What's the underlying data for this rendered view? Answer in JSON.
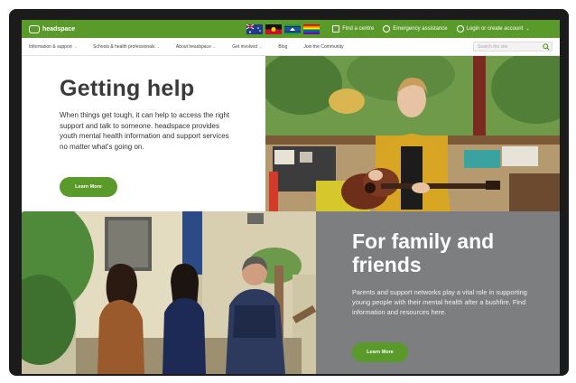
{
  "brand": {
    "name": "headspace",
    "color": "#5a9a2a"
  },
  "topbar": {
    "flags": [
      "australian-flag",
      "aboriginal-flag",
      "torres-strait-islander-flag",
      "rainbow-pride-flag"
    ],
    "find_centre": "Find a centre",
    "emergency": "Emergency assistance",
    "login": "Login or create account"
  },
  "nav": {
    "items": [
      {
        "label": "Information & support",
        "caret": "⌄"
      },
      {
        "label": "Schools & health professionals",
        "caret": "⌄"
      },
      {
        "label": "About headspace",
        "caret": "⌄"
      },
      {
        "label": "Get involved",
        "caret": "⌄"
      },
      {
        "label": "Blog"
      },
      {
        "label": "Join the Community"
      }
    ],
    "search_placeholder": "Search the site"
  },
  "hero": {
    "title": "Getting help",
    "text": "When things get tough, it can help to access the right support and talk to someone. headspace provides youth mental health information and support services no matter what's going on.",
    "button": "Learn More"
  },
  "family": {
    "title": "For family and friends",
    "text": "Parents and support networks play a vital role in supporting young people with their mental health after a bushfire. Find information and resources here.",
    "button": "Learn More"
  }
}
